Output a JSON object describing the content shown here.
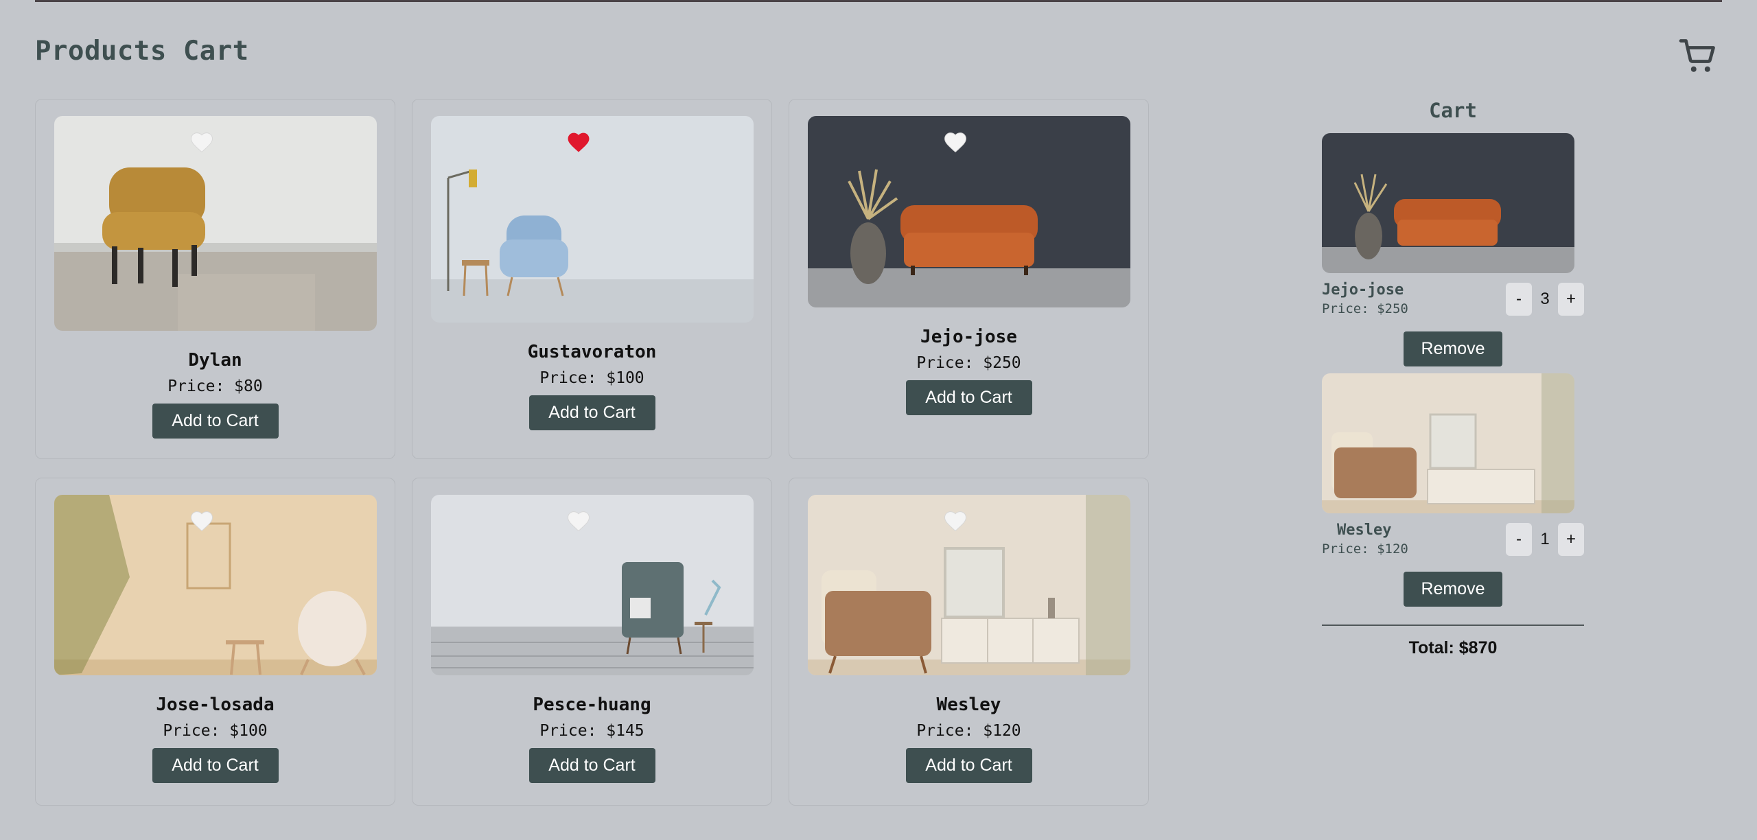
{
  "header": {
    "title": "Products Cart",
    "cart_icon": "shopping-cart-icon"
  },
  "products": [
    {
      "name": "Dylan",
      "price": "Price: $80",
      "button": "Add to Cart",
      "favorite": false
    },
    {
      "name": "Gustavoraton",
      "price": "Price: $100",
      "button": "Add to Cart",
      "favorite": true
    },
    {
      "name": "Jejo-jose",
      "price": "Price: $250",
      "button": "Add to Cart",
      "favorite": false
    },
    {
      "name": "Jose-losada",
      "price": "Price: $100",
      "button": "Add to Cart",
      "favorite": false
    },
    {
      "name": "Pesce-huang",
      "price": "Price: $145",
      "button": "Add to Cart",
      "favorite": false
    },
    {
      "name": "Wesley",
      "price": "Price: $120",
      "button": "Add to Cart",
      "favorite": false
    }
  ],
  "cart": {
    "title": "Cart",
    "items": [
      {
        "name": "Jejo-jose",
        "price": "Price: $250",
        "quantity": "3",
        "minus": "-",
        "plus": "+",
        "remove": "Remove"
      },
      {
        "name": "Wesley",
        "price": "Price: $120",
        "quantity": "1",
        "minus": "-",
        "plus": "+",
        "remove": "Remove"
      }
    ],
    "total": "Total: $870"
  },
  "colors": {
    "background": "#c3c6cb",
    "accent": "#3e4f50",
    "heart_active": "#e0182d",
    "heart_inactive": "#ffffff"
  }
}
